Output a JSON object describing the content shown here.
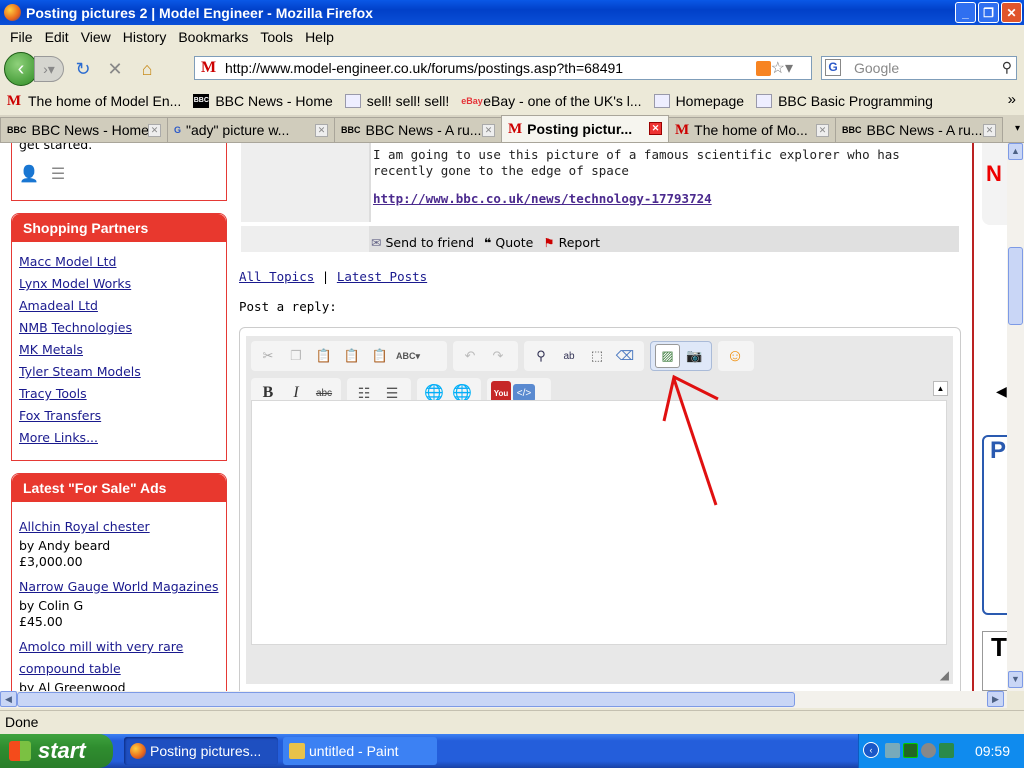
{
  "window": {
    "title": "Posting pictures 2 | Model Engineer - Mozilla Firefox"
  },
  "menu": [
    "File",
    "Edit",
    "View",
    "History",
    "Bookmarks",
    "Tools",
    "Help"
  ],
  "url": "http://www.model-engineer.co.uk/forums/postings.asp?th=68491",
  "search_placeholder": "Google",
  "bookmarks": [
    {
      "label": "The home of Model En...",
      "icon": "M"
    },
    {
      "label": "BBC News - Home",
      "icon": "BBC"
    },
    {
      "label": "sell! sell! sell!",
      "icon": "page"
    },
    {
      "label": "eBay - one of the UK's l...",
      "icon": "eBay"
    },
    {
      "label": "Homepage",
      "icon": "page"
    },
    {
      "label": "BBC Basic Programming",
      "icon": "page"
    }
  ],
  "tabs": [
    {
      "label": "BBC News - Home",
      "icon": "BBC"
    },
    {
      "label": "\"ady\" picture w...",
      "icon": "G"
    },
    {
      "label": "BBC News - A ru...",
      "icon": "BBC"
    },
    {
      "label": "Posting pictur...",
      "icon": "M",
      "active": true
    },
    {
      "label": "The home of Mo...",
      "icon": "M"
    },
    {
      "label": "BBC News - A ru...",
      "icon": "BBC"
    }
  ],
  "sidebar": {
    "get_started": "get started.",
    "partners_title": "Shopping Partners",
    "partners": [
      "Macc Model Ltd",
      "Lynx Model Works",
      "Amadeal Ltd",
      "NMB Technologies",
      "MK Metals",
      "Tyler Steam Models",
      "Tracy Tools",
      "Fox Transfers",
      "More Links..."
    ],
    "ads_title": "Latest \"For Sale\" Ads",
    "ads": [
      {
        "title": "Allchin Royal chester",
        "by": "by Andy beard",
        "price": "£3,000.00"
      },
      {
        "title": "Narrow Gauge World Magazines",
        "by": "by Colin G",
        "price": "£45.00"
      },
      {
        "title": "Amolco mill with very rare compound table",
        "by": "by Al Greenwood",
        "price": ""
      }
    ]
  },
  "post": {
    "text": "I am going to use this picture of a famous scientific explorer who has recently gone to the edge of space",
    "link": "http://www.bbc.co.uk/news/technology-17793724",
    "actions": [
      "Send to friend",
      "Quote",
      "Report"
    ]
  },
  "nav_links": {
    "all_topics": "All Topics",
    "sep": "|",
    "latest_posts": "Latest Posts"
  },
  "reply_label": "Post a reply:",
  "status": "Done",
  "taskbar": {
    "start": "start",
    "items": [
      "Posting pictures...",
      "untitled - Paint"
    ],
    "clock": "09:59"
  },
  "colors": {
    "sidebar_header": "#e8382e",
    "annotation_arrow": "#e01010",
    "link": "#1a1a8e"
  }
}
